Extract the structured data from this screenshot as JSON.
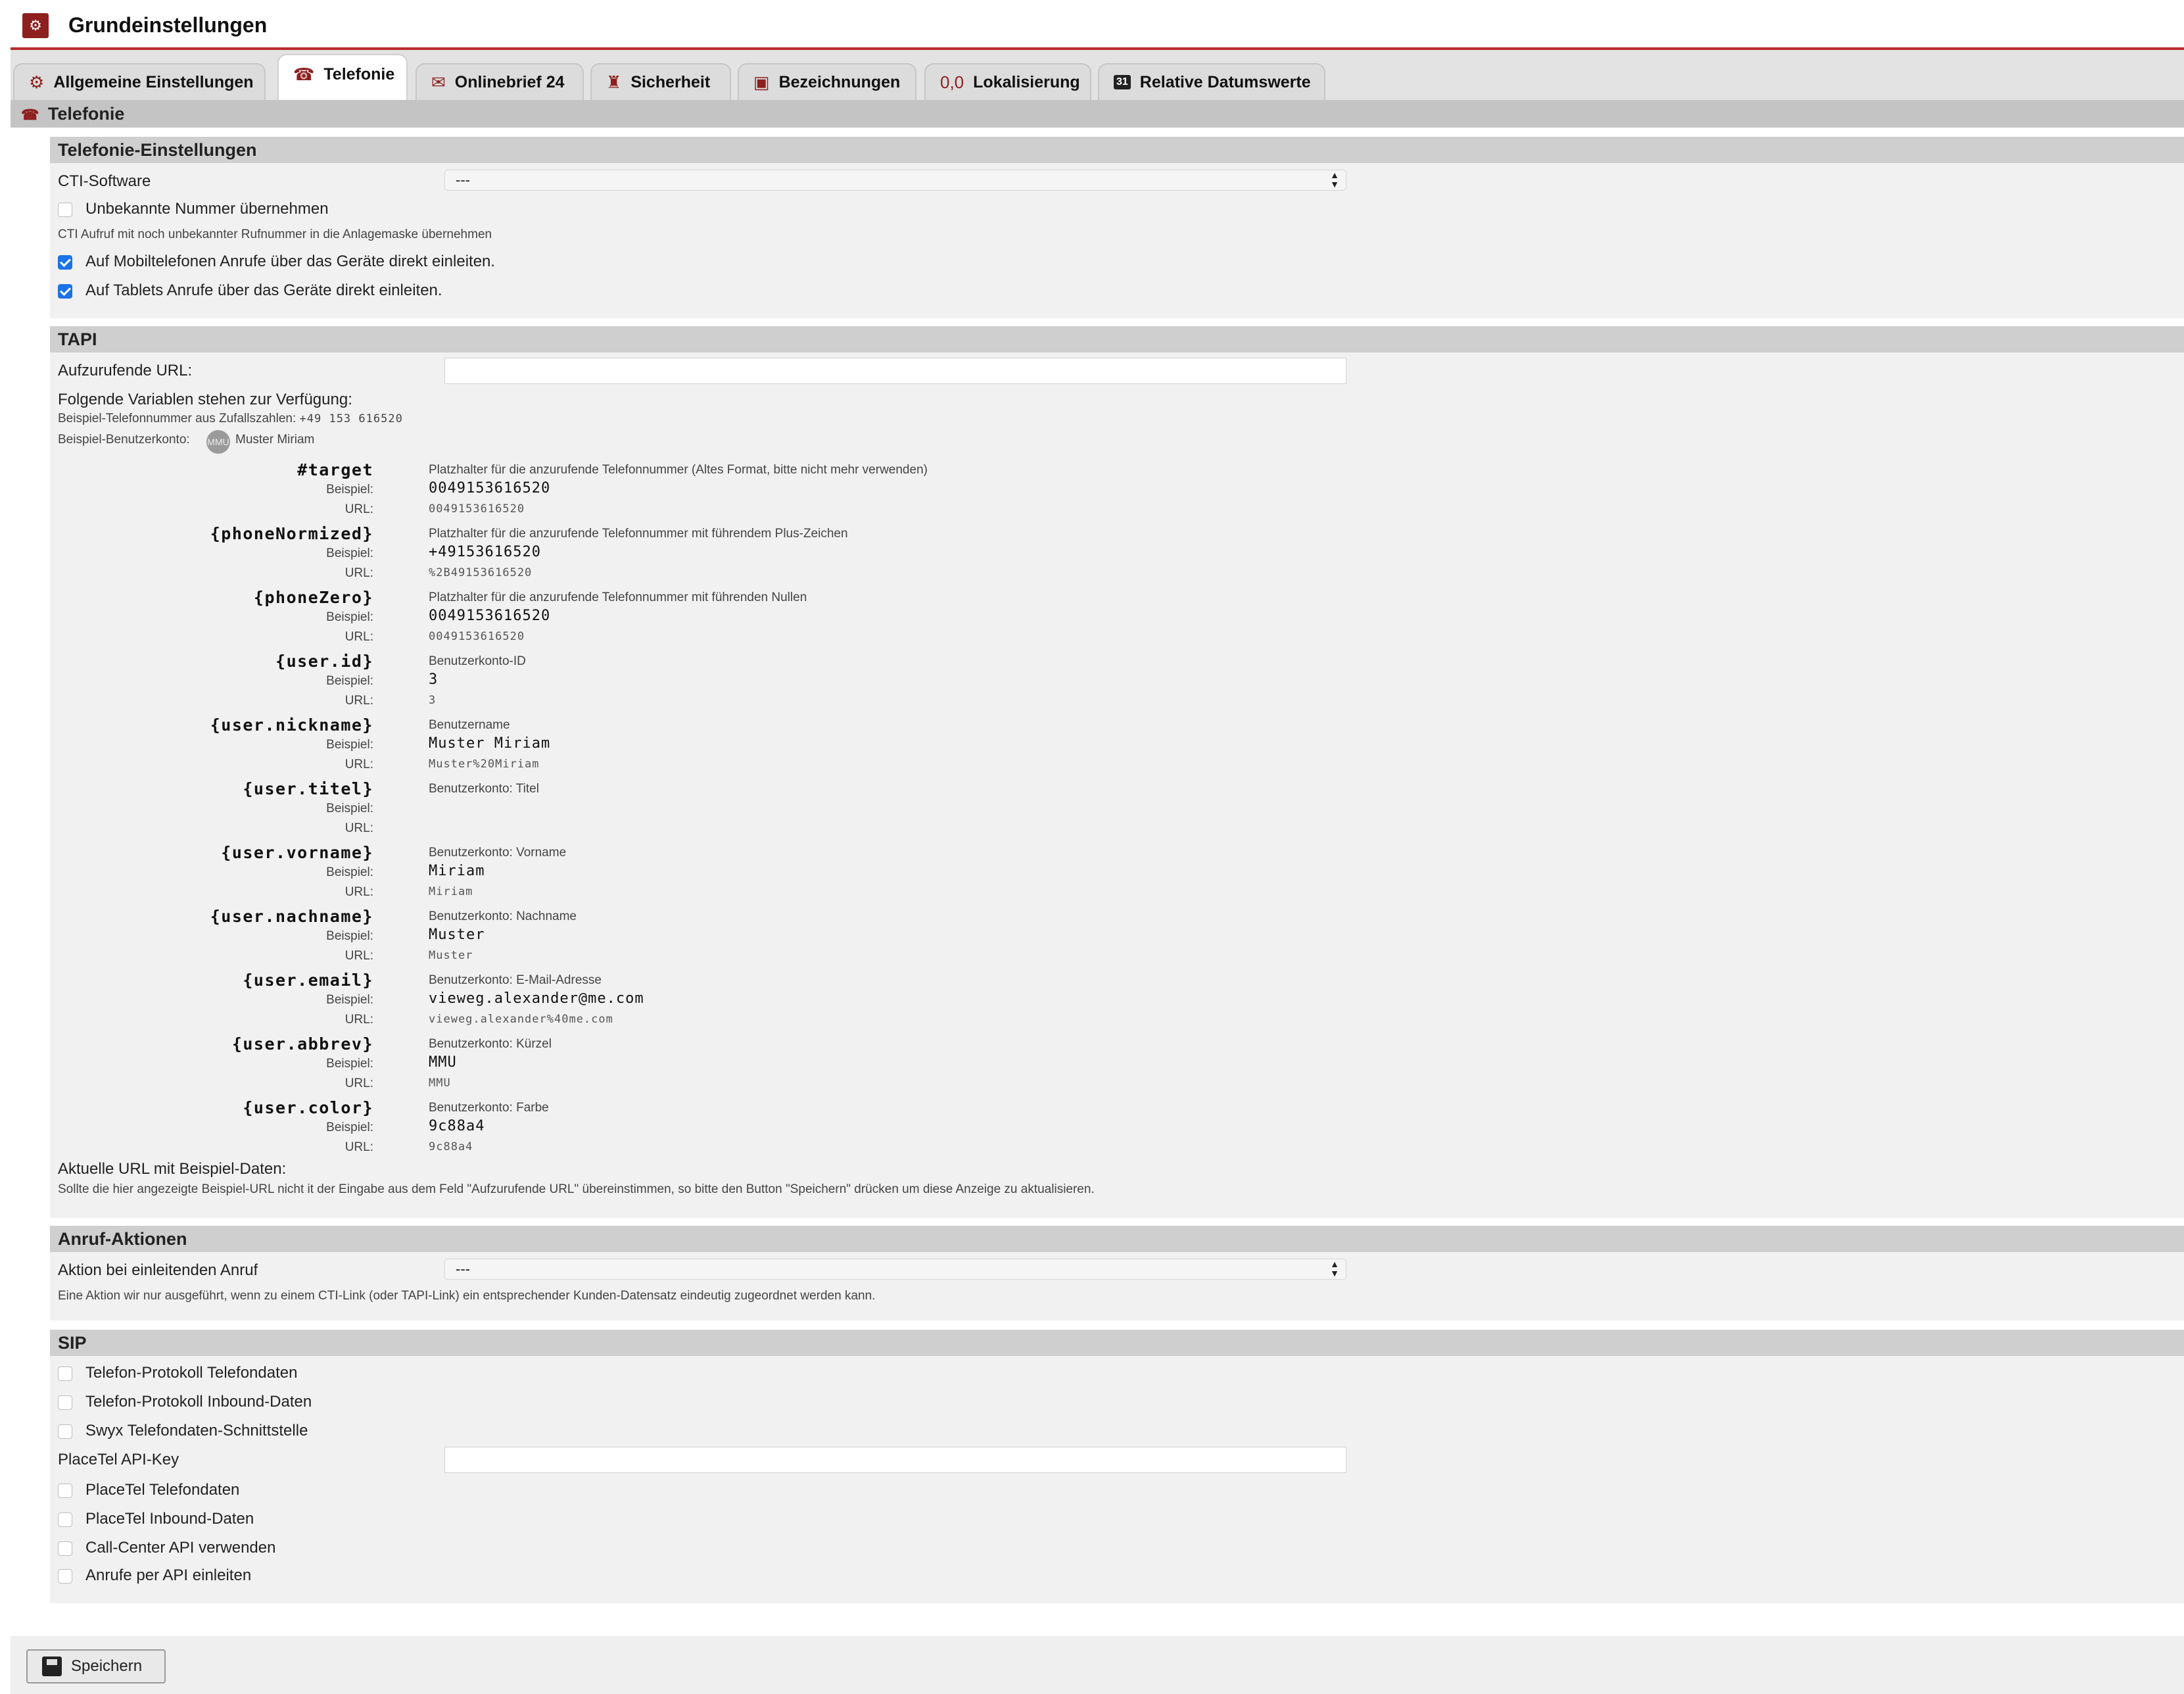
{
  "header": {
    "title": "Grundeinstellungen",
    "icon": "settings-sliders-icon"
  },
  "tabs": [
    {
      "label": "Allgemeine Einstellungen",
      "icon": "gears-icon"
    },
    {
      "label": "Telefonie",
      "icon": "telephone-icon",
      "active": true
    },
    {
      "label": "Onlinebrief 24",
      "icon": "letter-24-icon"
    },
    {
      "label": "Sicherheit",
      "icon": "security-icon"
    },
    {
      "label": "Bezeichnungen",
      "icon": "labels-icon"
    },
    {
      "label": "Lokalisierung",
      "icon_text": "0,0"
    },
    {
      "label": "Relative Datumswerte",
      "icon": "calendar-icon",
      "icon_text": "31"
    }
  ],
  "section": {
    "title": "Telefonie"
  },
  "telefonie": {
    "title": "Telefonie-Einstellungen",
    "cti_label": "CTI-Software",
    "cti_value": "---",
    "unknown_label": "Unbekannte Nummer übernehmen",
    "unknown_hint": "CTI Aufruf mit noch unbekannter Rufnummer in die Anlagemaske übernehmen",
    "mobile_label": "Auf Mobiltelefonen Anrufe über das Geräte direkt einleiten.",
    "tablet_label": "Auf Tablets Anrufe über das Geräte direkt einleiten."
  },
  "tapi": {
    "title": "TAPI",
    "url_label": "Aufzurufende URL:",
    "url_value": "",
    "vars_label": "Folgende Variablen stehen zur Verfügung:",
    "example_phone_label": "Beispiel-Telefonnummer aus Zufallszahlen:",
    "example_phone": "+49 153 616520",
    "example_account_label": "Beispiel-Benutzerkonto:",
    "example_account_abbrev": "MMU",
    "example_account_name": "Muster Miriam",
    "beispiel_label": "Beispiel:",
    "url_sub_label": "URL:",
    "variables": [
      {
        "name": "#target",
        "desc": "Platzhalter für die anzurufende Telefonnummer (Altes Format, bitte nicht mehr verwenden)",
        "example": "0049153616520",
        "url": "0049153616520"
      },
      {
        "name": "{phoneNormized}",
        "desc": "Platzhalter für die anzurufende Telefonnummer mit führendem Plus-Zeichen",
        "example": "+49153616520",
        "url": "%2B49153616520"
      },
      {
        "name": "{phoneZero}",
        "desc": "Platzhalter für die anzurufende Telefonnummer mit führenden Nullen",
        "example": "0049153616520",
        "url": "0049153616520"
      },
      {
        "name": "{user.id}",
        "desc": "Benutzerkonto-ID",
        "example": "3",
        "url": "3"
      },
      {
        "name": "{user.nickname}",
        "desc": "Benutzername",
        "example": "Muster Miriam",
        "url": "Muster%20Miriam"
      },
      {
        "name": "{user.titel}",
        "desc": "Benutzerkonto: Titel",
        "example": "",
        "url": ""
      },
      {
        "name": "{user.vorname}",
        "desc": "Benutzerkonto: Vorname",
        "example": "Miriam",
        "url": "Miriam"
      },
      {
        "name": "{user.nachname}",
        "desc": "Benutzerkonto: Nachname",
        "example": "Muster",
        "url": "Muster"
      },
      {
        "name": "{user.email}",
        "desc": "Benutzerkonto: E-Mail-Adresse",
        "example": "vieweg.alexander@me.com",
        "url": "vieweg.alexander%40me.com"
      },
      {
        "name": "{user.abbrev}",
        "desc": "Benutzerkonto: Kürzel",
        "example": "MMU",
        "url": "MMU"
      },
      {
        "name": "{user.color}",
        "desc": "Benutzerkonto: Farbe",
        "example": "9c88a4",
        "url": "9c88a4"
      }
    ],
    "current_url_label": "Aktuelle URL mit Beispiel-Daten:",
    "current_url_hint": "Sollte die hier angezeigte Beispiel-URL nicht it der Eingabe aus dem Feld \"Aufzurufende URL\" übereinstimmen, so bitte den Button \"Speichern\" drücken um diese Anzeige zu aktualisieren."
  },
  "anruf": {
    "title": "Anruf-Aktionen",
    "action_label": "Aktion bei einleitenden Anruf",
    "action_value": "---",
    "hint": "Eine Aktion wir nur ausgeführt, wenn zu einem CTI-Link (oder TAPI-Link) ein entsprechender Kunden-Datensatz eindeutig zugeordnet werden kann."
  },
  "sip": {
    "title": "SIP",
    "protokoll_telefondaten": "Telefon-Protokoll Telefondaten",
    "protokoll_inbound": "Telefon-Protokoll Inbound-Daten",
    "swyx": "Swyx Telefondaten-Schnittstelle",
    "placetel_key_label": "PlaceTel API-Key",
    "placetel_key_value": "",
    "placetel_telefondaten": "PlaceTel Telefondaten",
    "placetel_inbound": "PlaceTel Inbound-Daten",
    "callcenter_api": "Call-Center API verwenden",
    "api_calls": "Anrufe per API einleiten"
  },
  "footer": {
    "save_label": "Speichern"
  },
  "colors": {
    "accent": "#b92c2c",
    "checkbox": "#1a73e8",
    "avatar": "#9c88a4"
  }
}
